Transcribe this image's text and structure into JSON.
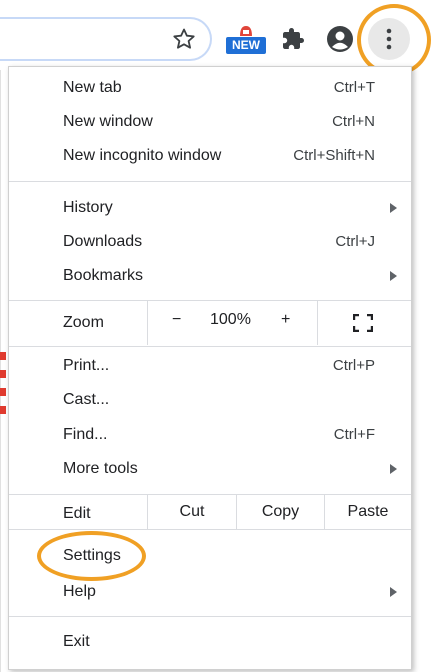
{
  "toolbar": {
    "bookmark_icon": "star-outline-icon",
    "extension_badge": "NEW",
    "extensions_icon": "puzzle-piece-icon",
    "profile_icon": "account-circle-icon",
    "menu_icon": "vertical-dots-icon",
    "highlight_color": "#f0a024"
  },
  "menu": {
    "group1": [
      {
        "label": "New tab",
        "shortcut": "Ctrl+T"
      },
      {
        "label": "New window",
        "shortcut": "Ctrl+N"
      },
      {
        "label": "New incognito window",
        "shortcut": "Ctrl+Shift+N"
      }
    ],
    "group2": [
      {
        "label": "History",
        "shortcut": "",
        "submenu": true
      },
      {
        "label": "Downloads",
        "shortcut": "Ctrl+J"
      },
      {
        "label": "Bookmarks",
        "shortcut": "",
        "submenu": true
      }
    ],
    "zoom": {
      "label": "Zoom",
      "minus": "−",
      "value": "100%",
      "plus": "+",
      "fullscreen_icon": "fullscreen-icon"
    },
    "group3": [
      {
        "label": "Print...",
        "shortcut": "Ctrl+P"
      },
      {
        "label": "Cast...",
        "shortcut": ""
      },
      {
        "label": "Find...",
        "shortcut": "Ctrl+F"
      },
      {
        "label": "More tools",
        "shortcut": "",
        "submenu": true
      }
    ],
    "edit": {
      "label": "Edit",
      "cut": "Cut",
      "copy": "Copy",
      "paste": "Paste"
    },
    "group4": [
      {
        "label": "Settings",
        "shortcut": ""
      },
      {
        "label": "Help",
        "shortcut": "",
        "submenu": true
      }
    ],
    "exit": {
      "label": "Exit"
    }
  }
}
